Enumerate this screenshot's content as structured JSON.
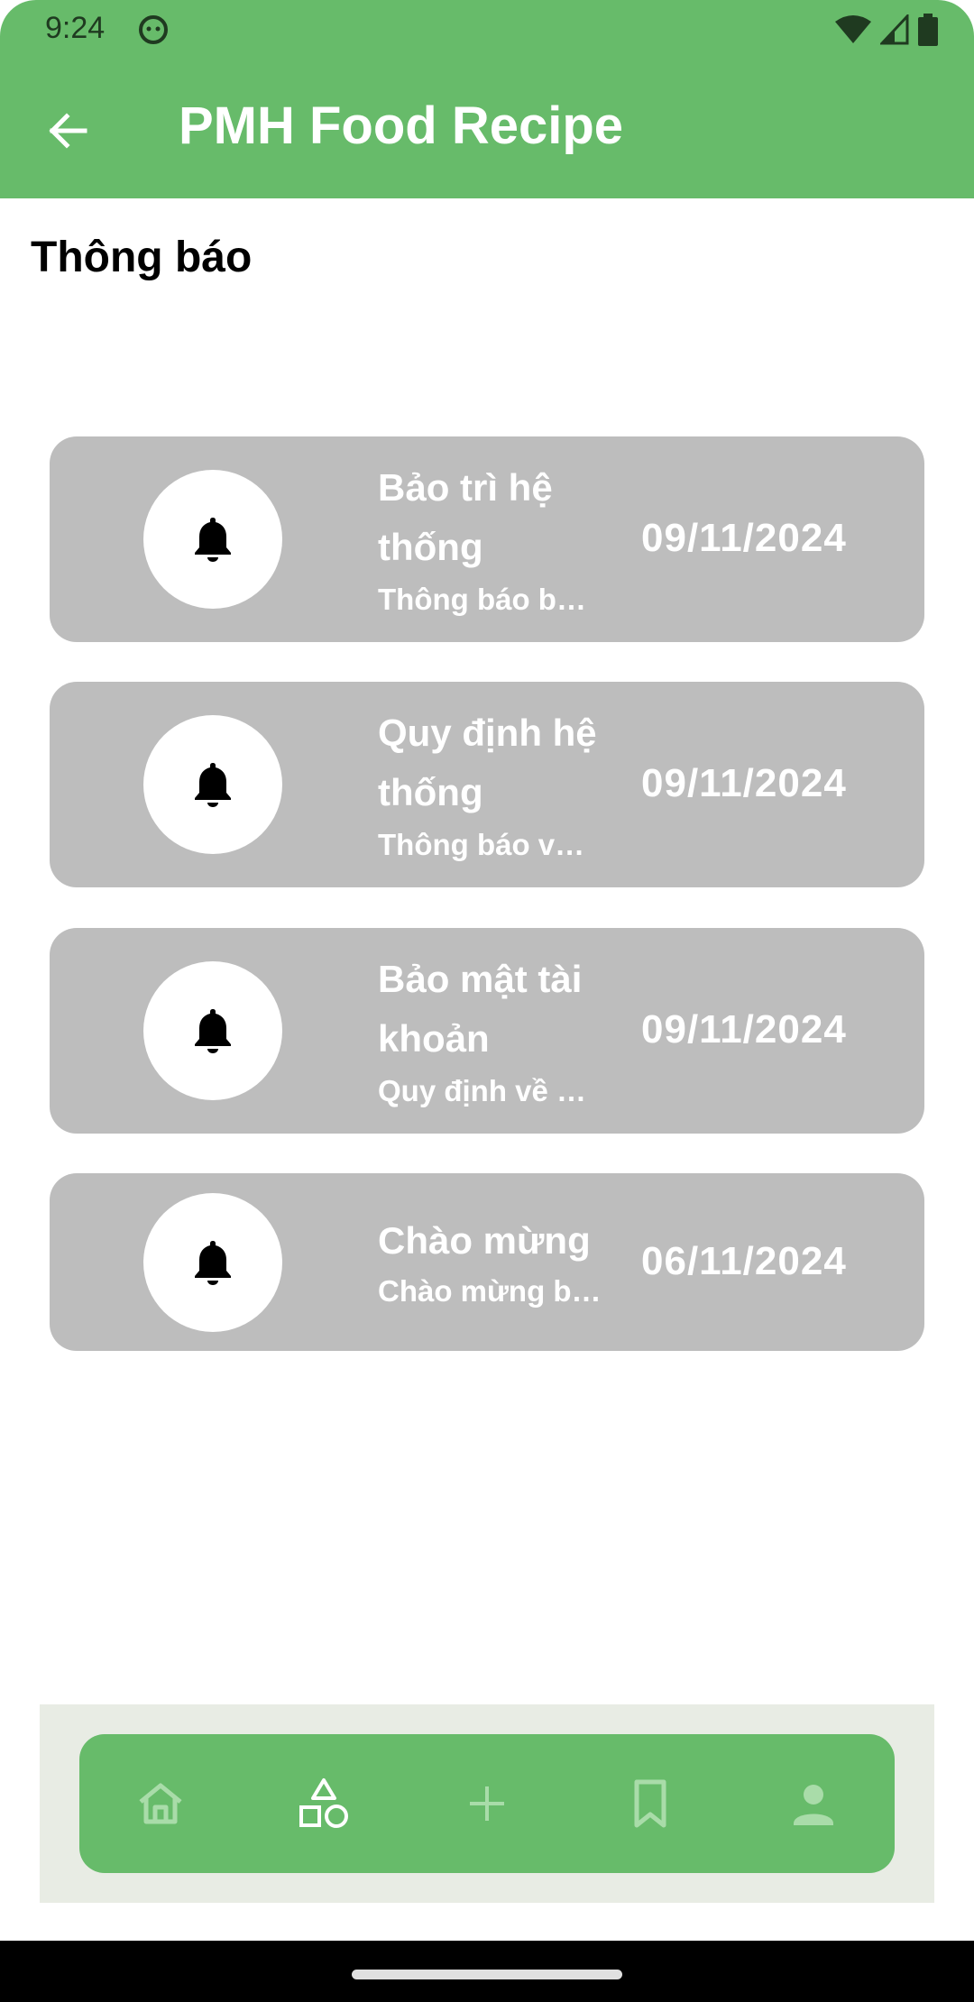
{
  "status_bar": {
    "time": "9:24"
  },
  "app_bar": {
    "title": "PMH Food Recipe"
  },
  "page": {
    "title": "Thông báo"
  },
  "notifications": [
    {
      "title": "Bảo trì hệ thống",
      "subtitle": "Thông báo b…",
      "date": "09/11/2024"
    },
    {
      "title": "Quy định hệ thống",
      "subtitle": "Thông báo v…",
      "date": "09/11/2024"
    },
    {
      "title": "Bảo mật tài khoản",
      "subtitle": "Quy định về …",
      "date": "09/11/2024"
    },
    {
      "title": "Chào mừng",
      "subtitle": "Chào mừng b…",
      "date": "06/11/2024"
    }
  ],
  "bottom_nav": {
    "items": [
      {
        "icon": "home-icon",
        "active": false
      },
      {
        "icon": "categories-icon",
        "active": true
      },
      {
        "icon": "add-icon",
        "active": false
      },
      {
        "icon": "bookmark-icon",
        "active": false
      },
      {
        "icon": "profile-icon",
        "active": false
      }
    ]
  },
  "colors": {
    "primary": "#67bb6a",
    "card": "#bdbdbd",
    "nav_inactive": "#a9dca9",
    "nav_active": "#ffffff"
  }
}
